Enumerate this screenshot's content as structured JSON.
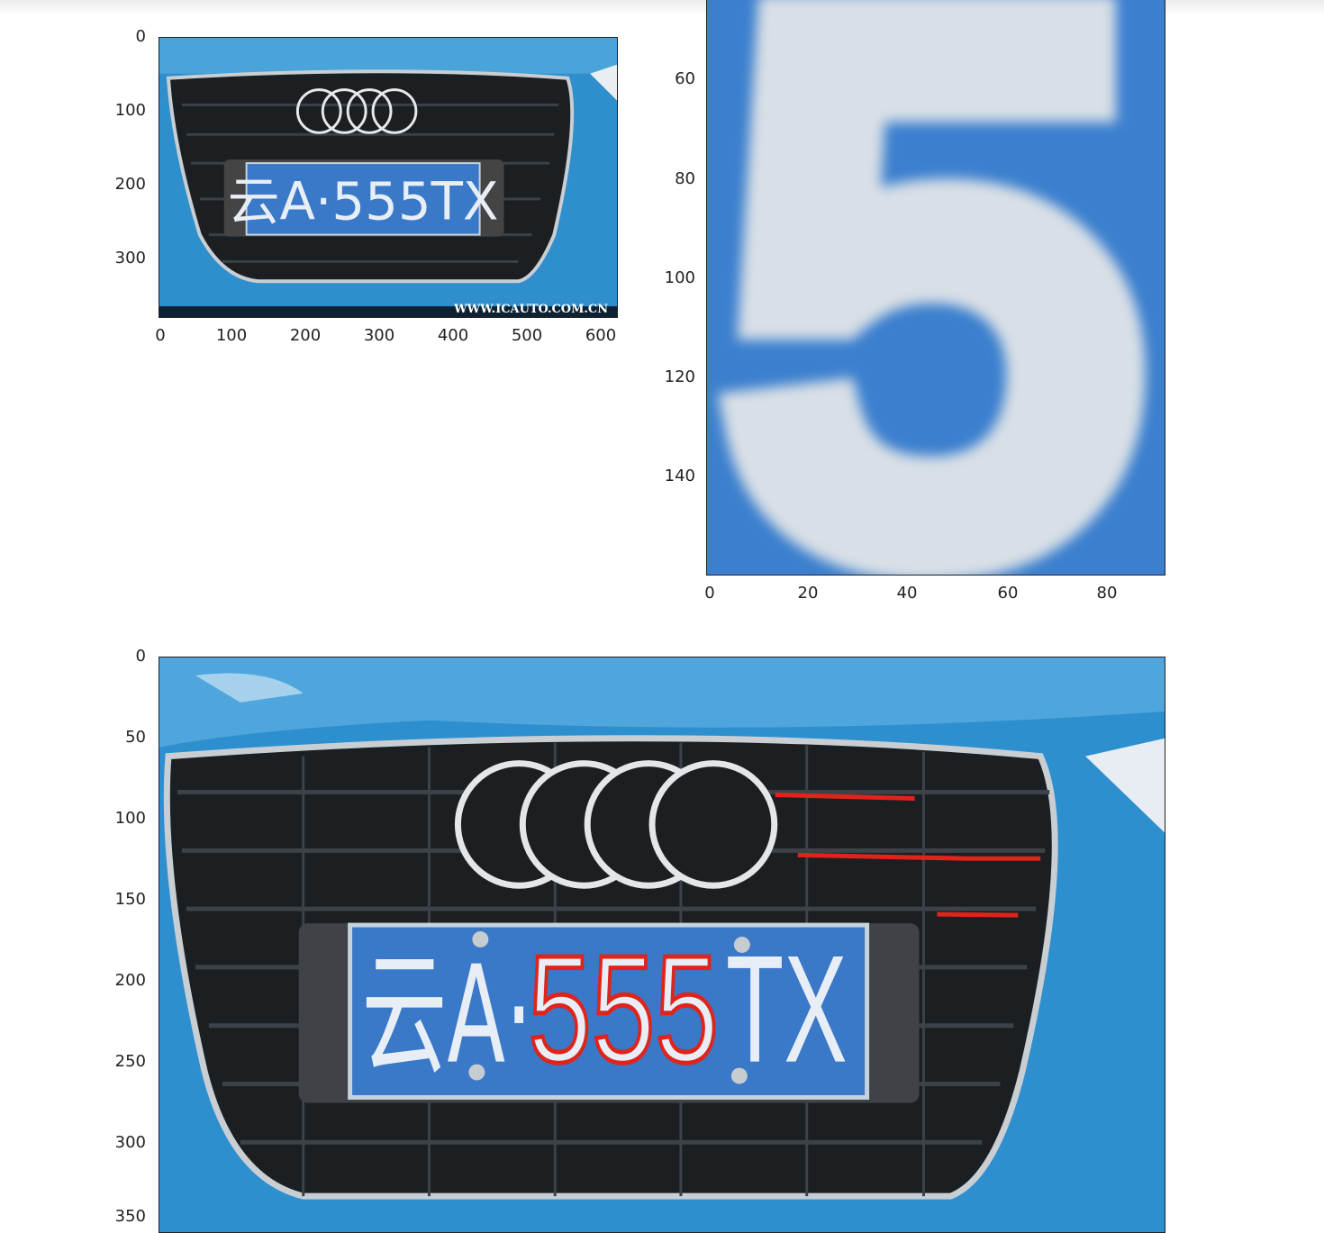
{
  "figure": {
    "panel1": {
      "yticks": [
        "0",
        "100",
        "200",
        "300"
      ],
      "xticks": [
        "0",
        "100",
        "200",
        "300",
        "400",
        "500",
        "600"
      ],
      "plate_text": "云A·555TX",
      "watermark": "WWW.ICAUTO.COM.CN"
    },
    "panel2": {
      "yticks": [
        "60",
        "80",
        "100",
        "120",
        "140"
      ],
      "xticks": [
        "0",
        "20",
        "40",
        "60",
        "80"
      ],
      "glyph": "5"
    },
    "panel3": {
      "yticks": [
        "0",
        "50",
        "100",
        "150",
        "200",
        "250",
        "300",
        "350"
      ],
      "plate_prefix": "云A·",
      "plate_digits": "555",
      "plate_suffix": "TX"
    }
  },
  "colors": {
    "car_blue": "#2e8fcf",
    "plate_blue": "#3a78c8",
    "grille": "#1c1f22",
    "contour_red": "#e0241b",
    "plate_text": "#e8eef5"
  }
}
